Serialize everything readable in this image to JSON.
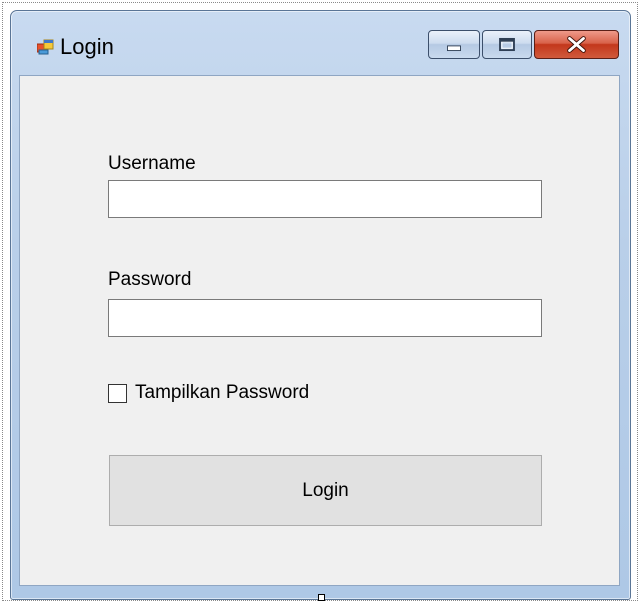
{
  "window": {
    "title": "Login",
    "icon": "windows-form-icon",
    "controls": {
      "minimize_icon": "minimize-icon",
      "maximize_icon": "maximize-icon",
      "close_icon": "close-icon"
    }
  },
  "form": {
    "username_label": "Username",
    "username_value": "",
    "password_label": "Password",
    "password_value": "",
    "show_password_label": "Tampilkan Password",
    "show_password_checked": false,
    "login_button_label": "Login"
  },
  "colors": {
    "client_background": "#f0f0f0",
    "close_button": "#c3371c",
    "frame": "#b9cfe9"
  }
}
